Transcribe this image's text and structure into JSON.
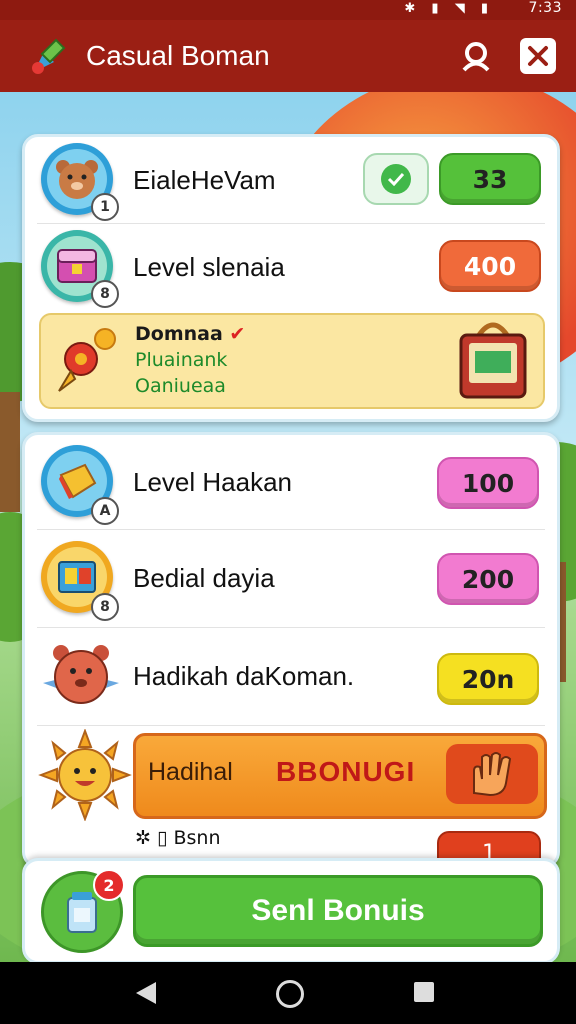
{
  "status_bar": {
    "time": "7:33",
    "icons": "✱ ▮ ◥ ▮"
  },
  "title_bar": {
    "app_title": "Casual Boman",
    "profile_icon": "user-icon",
    "close_icon": "close-icon"
  },
  "top_card": {
    "rows": [
      {
        "label": "EialeHeVam",
        "badge": "1",
        "value": "33",
        "color": "#55c13a",
        "check_icon": "check-icon"
      },
      {
        "label": "Level slenaia",
        "badge": "8",
        "value": "400",
        "color": "#f06a3a"
      }
    ],
    "promo": {
      "line1": "Domnaa",
      "line2": "Pluainank",
      "line3": "Oaniueaa",
      "mark": "✔"
    }
  },
  "list_card": {
    "rows": [
      {
        "label": "Level Haakan",
        "badge": "A",
        "value": "100",
        "color": "#f27bd0"
      },
      {
        "label": "Bedial dayia",
        "badge": "8",
        "value": "200",
        "color": "#f27bd0"
      },
      {
        "label": "Hadikah daKoman.",
        "value": "20n",
        "color": "#f5e021"
      }
    ],
    "bonus_banner": {
      "label": "Hadihal",
      "bonus_text": "BBONUGI"
    },
    "small_row": {
      "icons": "✲ ▯",
      "label": "Bsnn"
    },
    "peek_button": "1"
  },
  "bottom": {
    "gift_count": "2",
    "send_label": "Senl Bonuis"
  },
  "nav": {
    "back": "back-icon",
    "home": "home-icon",
    "recent": "recent-apps-icon"
  }
}
